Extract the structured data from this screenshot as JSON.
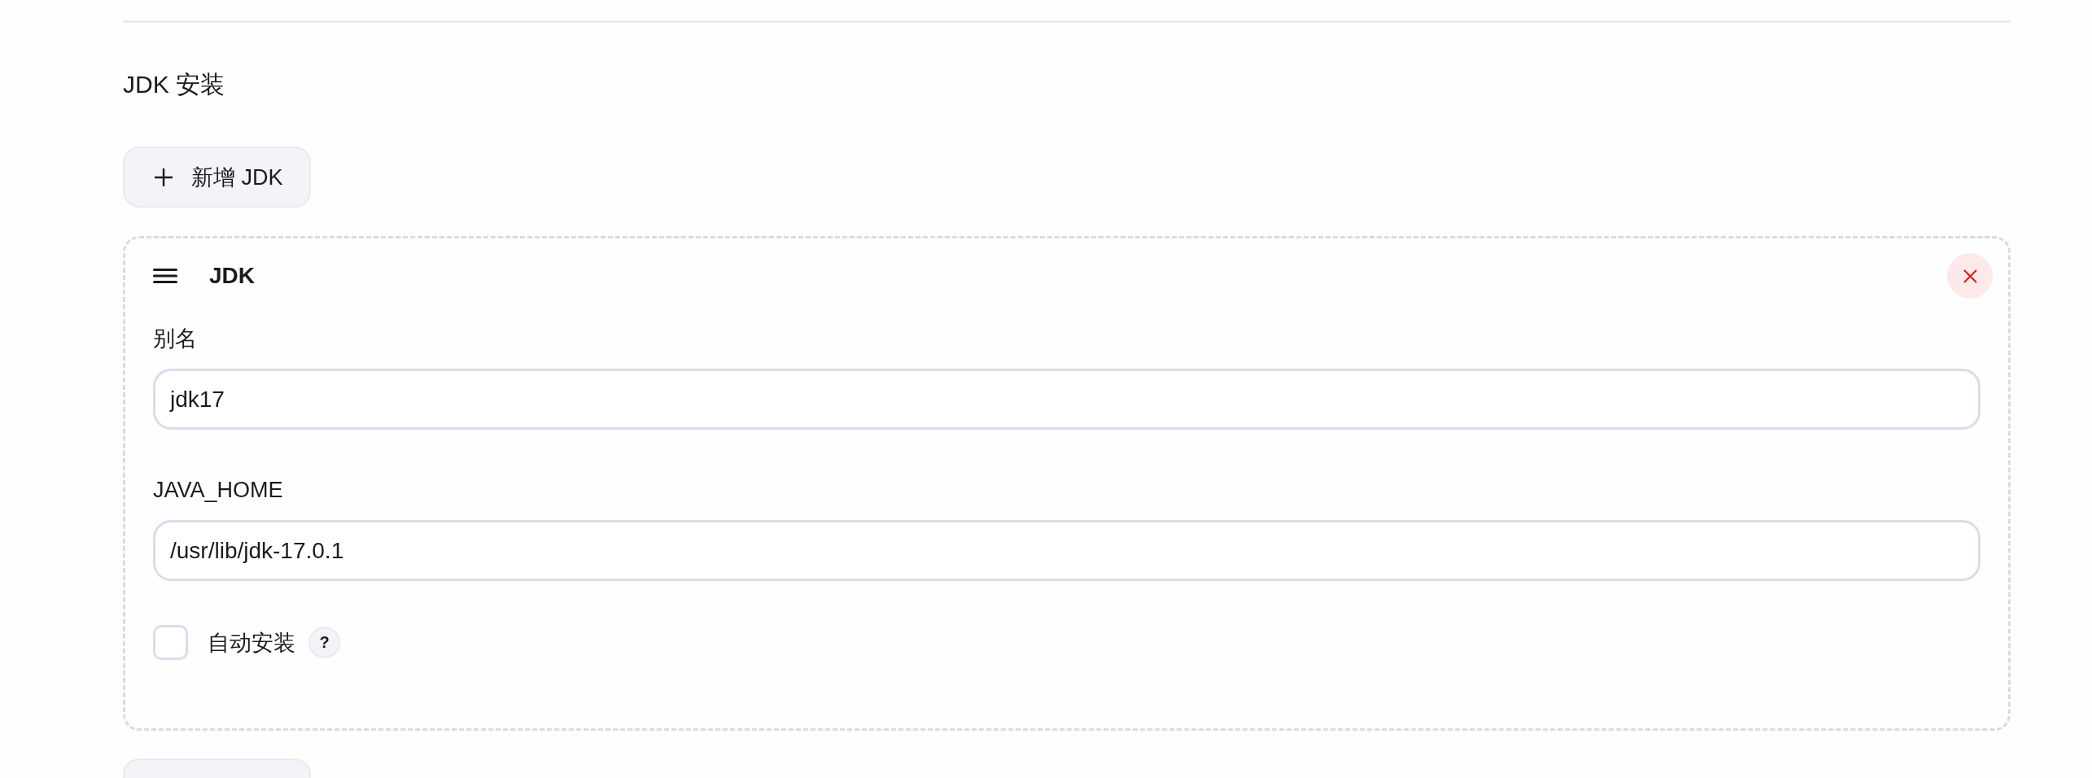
{
  "section": {
    "title": "JDK 安装"
  },
  "add_button": {
    "label": "新增 JDK"
  },
  "installations": [
    {
      "title": "JDK",
      "fields": [
        {
          "label": "别名",
          "value": "jdk17"
        },
        {
          "label": "JAVA_HOME",
          "value": "/usr/lib/jdk-17.0.1"
        }
      ],
      "auto_install": {
        "label": "自动安装",
        "checked": false,
        "help": "?"
      }
    }
  ]
}
